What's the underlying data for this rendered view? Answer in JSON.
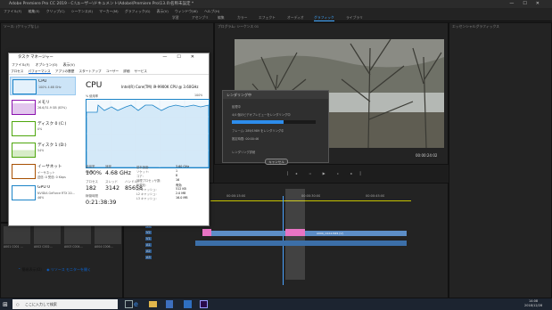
{
  "premiere": {
    "title": "Adobe Premiere Pro CC 2019 - C:\\ユーザー\\ドキュメント\\Adobe\\Premiere Pro\\13.0\\名称未設定 *",
    "menu": [
      "ファイル(F)",
      "編集(E)",
      "クリップ(C)",
      "シーケンス(S)",
      "マーカー(M)",
      "グラフィック(G)",
      "表示(V)",
      "ウィンドウ(W)",
      "ヘルプ(H)"
    ],
    "workspaces": [
      {
        "label": "学習",
        "active": false
      },
      {
        "label": "アセンブリ",
        "active": false
      },
      {
        "label": "編集",
        "active": false
      },
      {
        "label": "カラー",
        "active": false
      },
      {
        "label": "エフェクト",
        "active": false
      },
      {
        "label": "オーディオ",
        "active": false
      },
      {
        "label": "グラフィック",
        "active": true
      },
      {
        "label": "ライブラリ",
        "active": false
      }
    ],
    "source_panel_title": "ソース: (クリップなし)",
    "program_timecode": "00:00:24:02",
    "timeline_timecodes": [
      "00:00:00:00",
      "00:00:15:00",
      "00:00:30:00",
      "00:00:45:00"
    ],
    "tracks": [
      "V3",
      "V2",
      "V1",
      "A1",
      "A2",
      "A3"
    ],
    "clip_label": "A009_C024.MP4 [V]",
    "bin_items": [
      {
        "name": "A001 C001 ..."
      },
      {
        "name": "A002 C002..."
      },
      {
        "name": "A003 C004..."
      },
      {
        "name": "A004 C006..."
      }
    ],
    "item_durations": [
      "1:30",
      "11:30:16",
      "11:56:10"
    ]
  },
  "task_manager": {
    "title": "タスク マネージャー",
    "menu": [
      "ファイル(F)",
      "オプション(O)",
      "表示(V)"
    ],
    "tabs": [
      {
        "label": "プロセス",
        "active": false
      },
      {
        "label": "パフォーマンス",
        "active": true
      },
      {
        "label": "アプリの履歴",
        "active": false
      },
      {
        "label": "スタートアップ",
        "active": false
      },
      {
        "label": "ユーザー",
        "active": false
      },
      {
        "label": "詳細",
        "active": false
      },
      {
        "label": "サービス",
        "active": false
      }
    ],
    "perf_items": [
      {
        "name": "CPU",
        "sub": "100%  4.68 GHz",
        "sub2": "",
        "color": "#1b83c7",
        "selected": true
      },
      {
        "name": "メモリ",
        "sub": "26.6/31.9 GB (83%)",
        "sub2": "",
        "color": "#8b12ae",
        "selected": false
      },
      {
        "name": "ディスク 0 (C:)",
        "sub": "0%",
        "sub2": "",
        "color": "#4da60c",
        "selected": false
      },
      {
        "name": "ディスク 1 (D:)",
        "sub": "54%",
        "sub2": "",
        "color": "#4da60c",
        "selected": false
      },
      {
        "name": "イーサネット",
        "sub": "イーサネット",
        "sub2": "送信: 0  受信: 0 Kbps",
        "color": "#a74f01",
        "selected": false
      },
      {
        "name": "GPU 0",
        "sub": "NVIDIA GeForce RTX 20...",
        "sub2": "46%",
        "color": "#1b83c7",
        "selected": false
      }
    ],
    "cpu": {
      "heading": "CPU",
      "model": "Intel(R) Core(TM) i9-9900K CPU @ 3.60GHz",
      "graph_label": "% 使用率",
      "graph_max": "100%",
      "graph_seconds": "60 秒",
      "usage_label": "使用率",
      "usage": "100%",
      "speed_label": "速度",
      "speed": "4.68 GHz",
      "proc_label": "プロセス",
      "procs": "182",
      "threads_label": "スレッド",
      "threads": "3142",
      "handles_label": "ハンドル",
      "handles": "85658",
      "uptime_label": "稼働時間",
      "uptime": "0:21:38:39",
      "details": [
        {
          "k": "基本速度:",
          "v": "3.60 GHz"
        },
        {
          "k": "ソケット:",
          "v": "1"
        },
        {
          "k": "コア:",
          "v": "8"
        },
        {
          "k": "論理プロセッサ数:",
          "v": "16"
        },
        {
          "k": "仮想化:",
          "v": "有効"
        },
        {
          "k": "L1 キャッシュ:",
          "v": "512 KB"
        },
        {
          "k": "L2 キャッシュ:",
          "v": "2.0 MB"
        },
        {
          "k": "L3 キャッシュ:",
          "v": "16.0 MB"
        }
      ]
    },
    "footer_brief": "簡易表示(D)",
    "footer_link": "リソース モニターを開く"
  },
  "render_dialog": {
    "title": "レンダリング中",
    "line1": "処理中",
    "line2": "4/4 個のビデオプレビューをレンダリング中",
    "line3": "フレーム: 289/1989 をレンダリング中",
    "line4": "推定時間: 00:00:46",
    "line5": "レンダリング詳細",
    "progress": 62,
    "cancel": "キャンセル"
  },
  "taskbar": {
    "search_placeholder": "ここに入力して検索",
    "time": "14:08",
    "date": "2018/12/28"
  }
}
